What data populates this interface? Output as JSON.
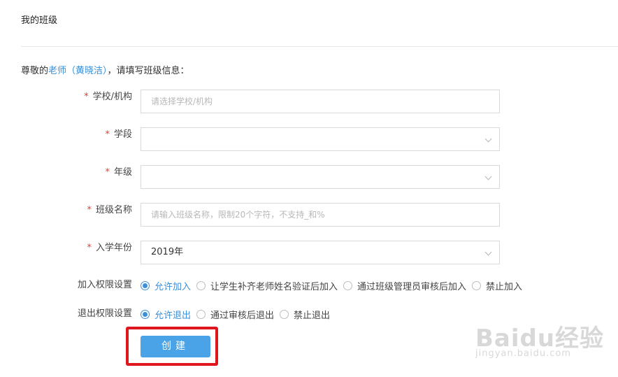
{
  "header": {
    "title": "我的班级"
  },
  "greeting": {
    "prefix": "尊敬的",
    "role": "老师（黄晓洁）",
    "suffix": "，请填写班级信息："
  },
  "form": {
    "required_mark": "*",
    "school": {
      "label": "学校/机构",
      "placeholder": "请选择学校/机构"
    },
    "stage": {
      "label": "学段",
      "value": ""
    },
    "grade": {
      "label": "年级",
      "value": ""
    },
    "class_name": {
      "label": "班级名称",
      "placeholder": "请输入班级名称，限制20个字符，不支持_和%"
    },
    "entry_year": {
      "label": "入学年份",
      "value": "2019年"
    },
    "join_permission": {
      "label": "加入权限设置",
      "options": [
        "允许加入",
        "让学生补齐老师姓名验证后加入",
        "通过班级管理员审核后加入",
        "禁止加入"
      ],
      "selected": "允许加入"
    },
    "exit_permission": {
      "label": "退出权限设置",
      "options": [
        "允许退出",
        "通过审核后退出",
        "禁止退出"
      ],
      "selected": "允许退出"
    },
    "create_button": "创建"
  },
  "watermark": {
    "logo": "Baidu经验",
    "url": "jingyan.baidu.com"
  },
  "colors": {
    "accent": "#3a8fd9",
    "button": "#4aa3e6",
    "required": "#e5412d",
    "highlight": "#e0161e"
  }
}
